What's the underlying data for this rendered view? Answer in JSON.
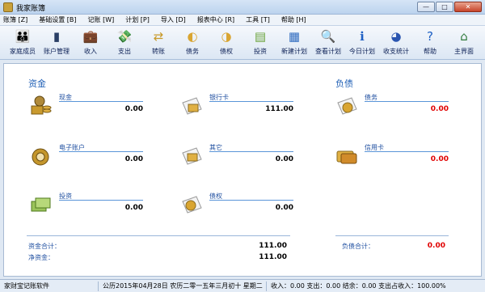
{
  "window": {
    "title": "我家账簿"
  },
  "window_buttons": {
    "minimize": "—",
    "maximize": "□",
    "close": "✕"
  },
  "menu": [
    {
      "label": "账簿 [Z]"
    },
    {
      "label": "基础设置 [B]"
    },
    {
      "label": "记账 [W]"
    },
    {
      "label": "计划 [P]"
    },
    {
      "label": "导入 [D]"
    },
    {
      "label": "报表中心 [R]"
    },
    {
      "label": "工具 [T]"
    },
    {
      "label": "帮助 [H]"
    }
  ],
  "toolbar": [
    {
      "label": "家庭成员",
      "icon": "family-icon",
      "glyph": "👪",
      "color": "#7a4a1e"
    },
    {
      "label": "账户管理",
      "icon": "account-manage-icon",
      "glyph": "▮",
      "color": "#2a3f66"
    },
    {
      "label": "收入",
      "icon": "income-icon",
      "glyph": "💼",
      "color": "#b04a1a"
    },
    {
      "label": "支出",
      "icon": "expense-icon",
      "glyph": "💸",
      "color": "#2e7d32"
    },
    {
      "label": "转账",
      "icon": "transfer-icon",
      "glyph": "⇄",
      "color": "#c89a2a"
    },
    {
      "label": "债务",
      "icon": "debt-icon",
      "glyph": "◐",
      "color": "#d9a531"
    },
    {
      "label": "债权",
      "icon": "credit-claim-icon",
      "glyph": "◑",
      "color": "#d9a531"
    },
    {
      "label": "投资",
      "icon": "invest-icon",
      "glyph": "▤",
      "color": "#6aa33a"
    },
    {
      "label": "新建计划",
      "icon": "new-plan-icon",
      "glyph": "▦",
      "color": "#2f6bbf"
    },
    {
      "label": "查看计划",
      "icon": "view-plan-icon",
      "glyph": "🔍",
      "color": "#2f6bbf"
    },
    {
      "label": "今日计划",
      "icon": "today-plan-icon",
      "glyph": "ℹ",
      "color": "#1d5fc4"
    },
    {
      "label": "收支统计",
      "icon": "stats-icon",
      "glyph": "◕",
      "color": "#2a55b0"
    },
    {
      "label": "帮助",
      "icon": "help-icon",
      "glyph": "?",
      "color": "#1d5fc4"
    },
    {
      "label": "主界面",
      "icon": "home-icon",
      "glyph": "⌂",
      "color": "#2f7a3a"
    }
  ],
  "assets": {
    "title": "资金",
    "accounts": [
      {
        "name": "现金",
        "value": "0.00",
        "icon": "cash-icon",
        "color": "#c99a2e"
      },
      {
        "name": "银行卡",
        "value": "111.00",
        "icon": "bank-card-icon",
        "color": "#e0b043"
      },
      {
        "name": "电子账户",
        "value": "0.00",
        "icon": "e-account-icon",
        "color": "#c4962c"
      },
      {
        "name": "其它",
        "value": "0.00",
        "icon": "other-icon",
        "color": "#e0b043"
      },
      {
        "name": "投资",
        "value": "0.00",
        "icon": "investment-icon",
        "color": "#9ac35a"
      },
      {
        "name": "债权",
        "value": "0.00",
        "icon": "claim-icon",
        "color": "#d9a531"
      }
    ],
    "total_label": "资金合计：",
    "total_value": "111.00",
    "net_label": "净资金：",
    "net_value": "111.00"
  },
  "liabilities": {
    "title": "负债",
    "accounts": [
      {
        "name": "债务",
        "value": "0.00",
        "icon": "debt-account-icon",
        "color": "#d9a531"
      },
      {
        "name": "信用卡",
        "value": "0.00",
        "icon": "credit-card-icon",
        "color": "#e0b043"
      }
    ],
    "total_label": "负债合计：",
    "total_value": "0.00"
  },
  "status": {
    "app": "家财宝记账软件",
    "date": "公历2015年04月28日  农历二零一五年三月初十  星期二",
    "summary": "收入：0.00 支出：0.00 结余：0.00 支出占收入：100.00%"
  }
}
